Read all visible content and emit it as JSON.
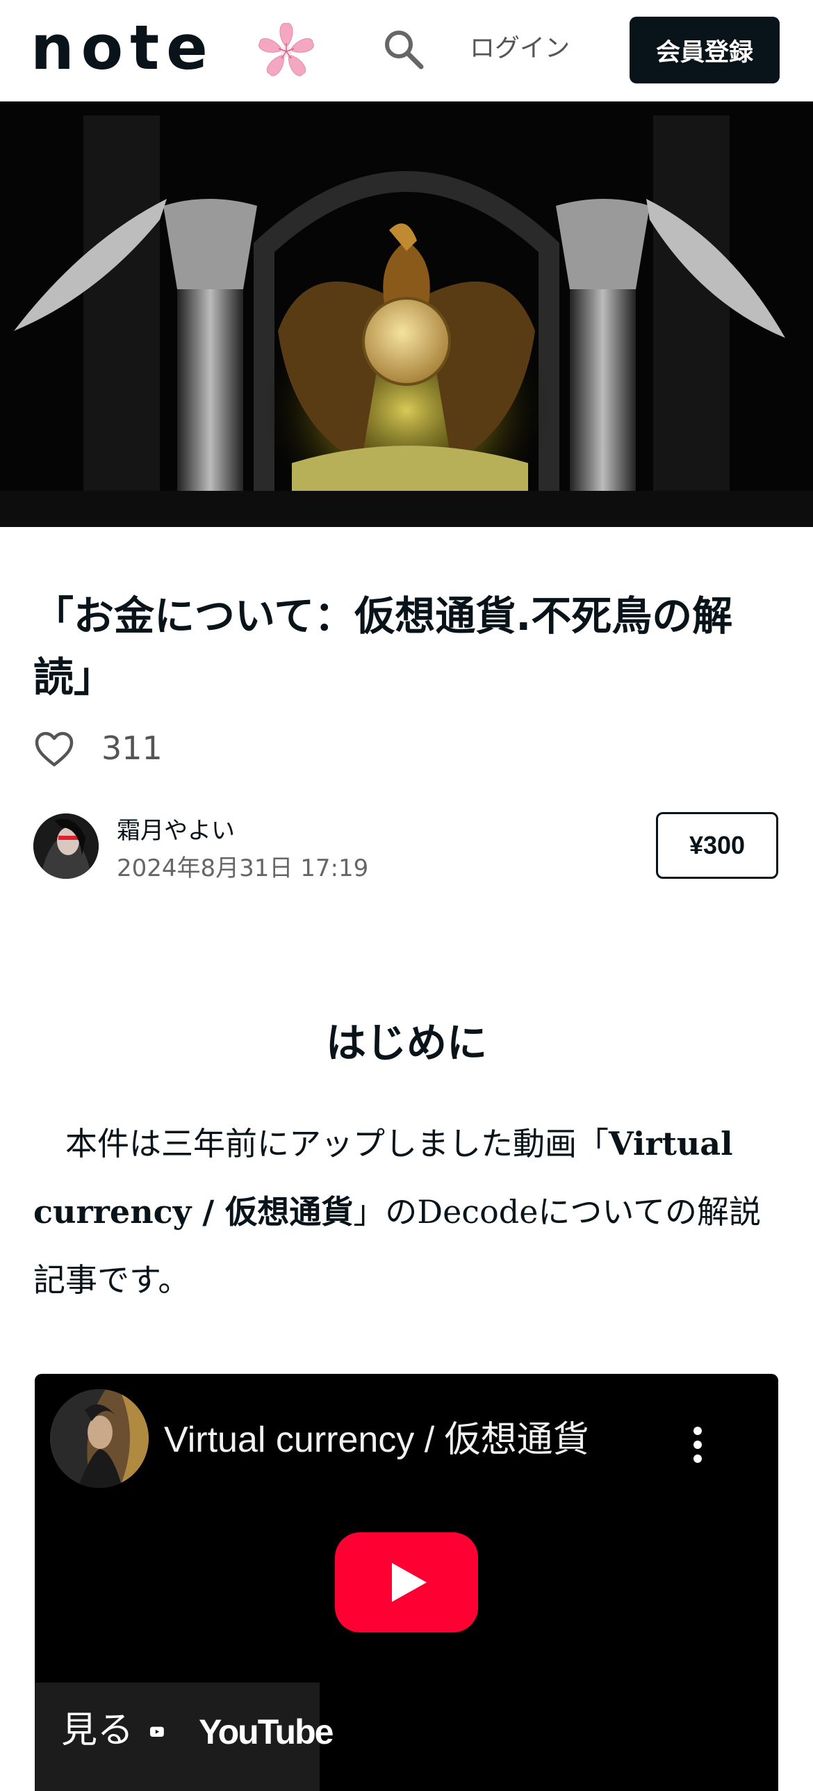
{
  "header": {
    "logo_text": "note",
    "login_label": "ログイン",
    "signup_label": "会員登録"
  },
  "article": {
    "title": "「お金について：仮想通貨.不死鳥の解読」",
    "like_count": "311",
    "author_name": "霜月やよい",
    "date": "2024年8月31日 17:19",
    "price_label": "¥300"
  },
  "content": {
    "heading": "はじめに",
    "para_prefix": "　本件は三年前にアップしました動画「",
    "para_bold": "Virtual currency / 仮想通貨",
    "para_suffix": "」のDecodeについての解説記事です。"
  },
  "video": {
    "title": "Virtual currency / 仮想通貨",
    "watch_label": "見る",
    "platform_label": "YouTube"
  },
  "colors": {
    "primary": "#08131a",
    "youtube_red": "#ff0033",
    "sakura_pink": "#f4a7c0"
  }
}
